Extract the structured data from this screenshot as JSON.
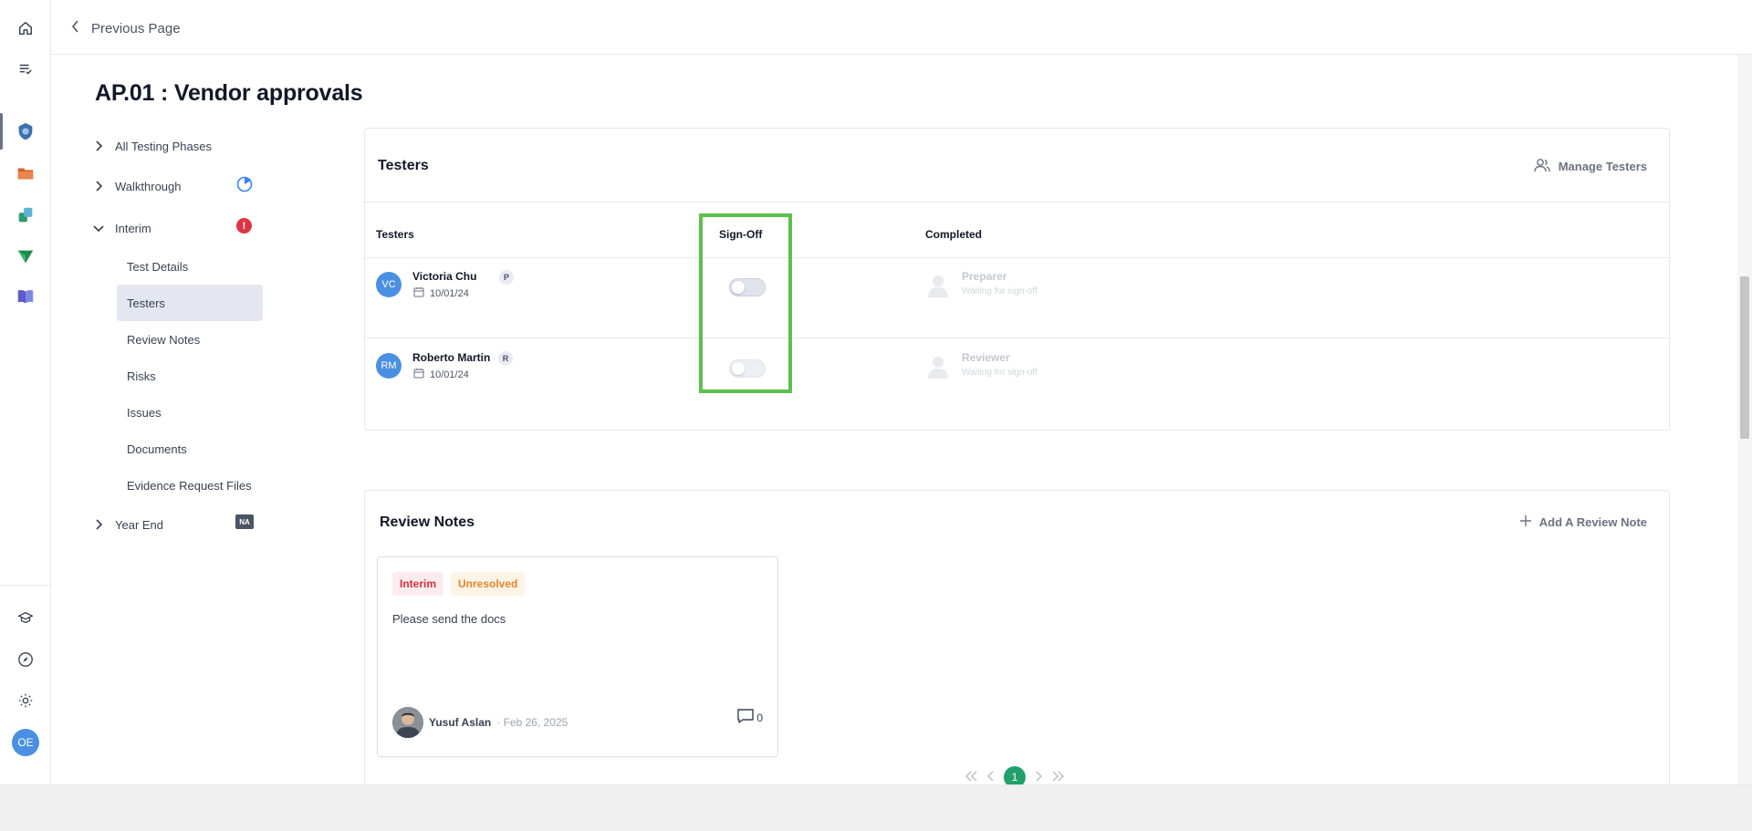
{
  "nav_top": {
    "back_label": "Previous Page"
  },
  "page": {
    "title": "AP.01 : Vendor approvals"
  },
  "phases": {
    "all": "All Testing Phases",
    "walkthrough": "Walkthrough",
    "interim": "Interim",
    "interim_badge": "!",
    "year_end": "Year End",
    "year_end_badge": "NA"
  },
  "sub_items": [
    "Test Details",
    "Testers",
    "Review Notes",
    "Risks",
    "Issues",
    "Documents",
    "Evidence Request Files"
  ],
  "testers_card": {
    "title": "Testers",
    "manage_label": "Manage Testers",
    "columns": [
      "Testers",
      "Sign-Off",
      "Completed"
    ],
    "rows": [
      {
        "initials": "VC",
        "name": "Victoria Chu",
        "role_badge": "P",
        "date": "10/01/24",
        "signoff": false,
        "completed_role": "Preparer",
        "completed_status": "Waiting for sign-off"
      },
      {
        "initials": "RM",
        "name": "Roberto Martin",
        "role_badge": "R",
        "date": "10/01/24",
        "signoff": false,
        "completed_role": "Reviewer",
        "completed_status": "Waiting for sign-off"
      }
    ]
  },
  "notes_card": {
    "title": "Review Notes",
    "add_label": "Add A Review Note",
    "note": {
      "tag_phase": "Interim",
      "tag_status": "Unresolved",
      "text": "Please send the docs",
      "author": "Yusuf Aslan",
      "date": "· Feb 26, 2025",
      "comments": "0"
    }
  },
  "pager": {
    "current": "1"
  },
  "user": {
    "initials": "OE"
  },
  "colors": {
    "accent": "#1a7f5a",
    "avatar": "#4a90e2",
    "highlight": "#5cc14a",
    "page_active": "#22a06b"
  }
}
